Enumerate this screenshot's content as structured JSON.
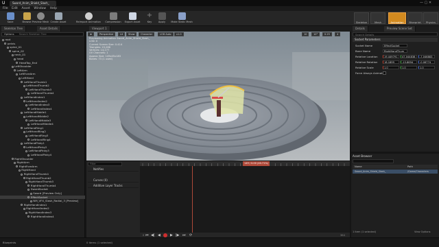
{
  "titlebar": {
    "tab": "Sword_Anim_Shield_Slash_"
  },
  "menubar": {
    "items": [
      "File",
      "Edit",
      "Asset",
      "Window",
      "Help"
    ]
  },
  "toolbar": {
    "buttons": [
      {
        "label": "Save",
        "icon": "save-icon",
        "color": "#6a8fc9"
      },
      {
        "label": "Browse",
        "icon": "browse-icon",
        "color": "#c9a44a"
      },
      {
        "label": "Preview Mesh",
        "icon": "mesh-icon",
        "color": "#8a8a8a"
      },
      {
        "label": "Create Asset",
        "icon": "create-asset-icon",
        "color": "#9aa6b2"
      },
      {
        "label": "Reimport Animation",
        "icon": "reimport-icon",
        "color": "#cfcfcf"
      },
      {
        "label": "Compression",
        "icon": "compression-icon",
        "color": "#7c7c7c"
      },
      {
        "label": "Export Asset",
        "icon": "export-icon",
        "color": "#cfd6e4"
      },
      {
        "label": "Key",
        "icon": "plus-icon",
        "color": "#555555"
      },
      {
        "label": "Apply",
        "icon": "apply-icon",
        "color": "#555555"
      },
      {
        "label": "Make Static Mesh",
        "icon": "static-mesh-icon",
        "color": "#8aa0c8"
      }
    ],
    "modes": [
      "Skeleton",
      "Mesh",
      "Animation",
      "Blueprint",
      "Physics"
    ],
    "active_mode": "Animation"
  },
  "tabs": {
    "left": "Skeleton Tree",
    "left2": "Asset Details",
    "right": "Preview Scene Set",
    "viewport": "Viewport 1"
  },
  "left": {
    "options": "Options",
    "search_placeholder": "Search Skeleton Tree",
    "tree": [
      {
        "label": "root",
        "indent": 0
      },
      {
        "label": "pelvis",
        "indent": 1
      },
      {
        "label": "spine_01",
        "indent": 2
      },
      {
        "label": "spine_02",
        "indent": 3
      },
      {
        "label": "neck_01",
        "indent": 4
      },
      {
        "label": "head",
        "indent": 5
      },
      {
        "label": "HeadTop_End",
        "indent": 6
      },
      {
        "label": "LeftShoulder",
        "indent": 4
      },
      {
        "label": "LeftArm",
        "indent": 5
      },
      {
        "label": "LeftForeArm",
        "indent": 6
      },
      {
        "label": "LeftHand",
        "indent": 7
      },
      {
        "label": "LeftHandThumb1",
        "indent": 8
      },
      {
        "label": "LeftHandThumb2",
        "indent": 9
      },
      {
        "label": "LeftHandThumb3",
        "indent": 10
      },
      {
        "label": "LeftHandThumb4",
        "indent": 11
      },
      {
        "label": "LeftHandIndex1",
        "indent": 8
      },
      {
        "label": "LeftHandIndex2",
        "indent": 9
      },
      {
        "label": "LeftHandIndex3",
        "indent": 10
      },
      {
        "label": "LeftHandIndex4",
        "indent": 11
      },
      {
        "label": "LeftHandMiddle1",
        "indent": 8
      },
      {
        "label": "LeftHandMiddle2",
        "indent": 9
      },
      {
        "label": "LeftHandMiddle3",
        "indent": 10
      },
      {
        "label": "LeftHandMiddle4",
        "indent": 11
      },
      {
        "label": "LeftHandRing1",
        "indent": 8
      },
      {
        "label": "LeftHandRing2",
        "indent": 9
      },
      {
        "label": "LeftHandRing3",
        "indent": 10
      },
      {
        "label": "LeftHandRing4",
        "indent": 11
      },
      {
        "label": "LeftHandPinky1",
        "indent": 8
      },
      {
        "label": "LeftHandPinky2",
        "indent": 9
      },
      {
        "label": "LeftHandPinky3",
        "indent": 10
      },
      {
        "label": "LeftHandPinky4",
        "indent": 11
      },
      {
        "label": "RightShoulder",
        "indent": 4
      },
      {
        "label": "RightArm",
        "indent": 5
      },
      {
        "label": "RightForeArm",
        "indent": 6
      },
      {
        "label": "RightHand",
        "indent": 7
      },
      {
        "label": "RightHandThumb1",
        "indent": 8
      },
      {
        "label": "RightHandThumb2",
        "indent": 9
      },
      {
        "label": "RightHandThumb3",
        "indent": 10
      },
      {
        "label": "RightHandThumb4",
        "indent": 11
      },
      {
        "label": "SwordSocket",
        "indent": 11
      },
      {
        "label": "Sword [Preview Only]",
        "indent": 12
      },
      {
        "label": "EffectSocket",
        "indent": 11,
        "selected": true
      },
      {
        "label": "NM_VFX_Slash_Radial_3 [Preview]",
        "indent": 12
      },
      {
        "label": "RightHandIndex1",
        "indent": 8
      },
      {
        "label": "RightHandIndex2",
        "indent": 9
      },
      {
        "label": "RightHandIndex3",
        "indent": 10
      },
      {
        "label": "RightHandIndex4",
        "indent": 11
      }
    ],
    "footer_label": "Blend Profile: None"
  },
  "viewport": {
    "toolbar": [
      "Perspective",
      "Lit",
      "Show",
      "Character",
      "LOD Auto",
      "x1.0"
    ],
    "right_values": [
      "10",
      "10°",
      "0.25",
      "4"
    ],
    "info_lines": [
      "Previewing Animation Sword_Anim_Shield_Slash_",
      "LOD: 0",
      "Current Screen Size: 0.414",
      "Triangles: 23,286",
      "Vertices: 14,277",
      "UV Channels: 1",
      "Approx Size: 149x45x183",
      "Bones: 73 (1 used)"
    ]
  },
  "timeline": {
    "tracks": [
      "Notifies",
      "Curves (0)",
      "Additive Layer Tracks"
    ],
    "filter_placeholder": "Filter",
    "playhead_label": "149 / 0.00 (40.71%)",
    "left_range": "0",
    "right_range": "364"
  },
  "details": {
    "search_placeholder": "Search Details",
    "section": "Socket Parameters",
    "rows": [
      {
        "label": "Socket Name",
        "value": "EffectSocket"
      },
      {
        "label": "Bone Name",
        "value": "RightHandThum"
      },
      {
        "label": "Relative Location",
        "values": [
          "19.449791",
          "47.044838",
          "-7.046883"
        ]
      },
      {
        "label": "Relative Rotation",
        "values": [
          "18.1899",
          "-15.8694",
          "-0.06774"
        ]
      },
      {
        "label": "Relative Scale",
        "values": [
          "1.0",
          "1.0",
          "1.0"
        ]
      },
      {
        "label": "Force Always Animate",
        "value": ""
      }
    ]
  },
  "assets": {
    "title": "Asset Browser",
    "view_options": "View Options",
    "col_name": "Name",
    "col_path": "Path",
    "item_name": "Sword_Anim_Shield_Slash_",
    "item_path": "/Game/Characters",
    "status": "1 item (1 selected)"
  },
  "status": {
    "left": "Blueprints",
    "center": "0 items (1 selected)"
  }
}
